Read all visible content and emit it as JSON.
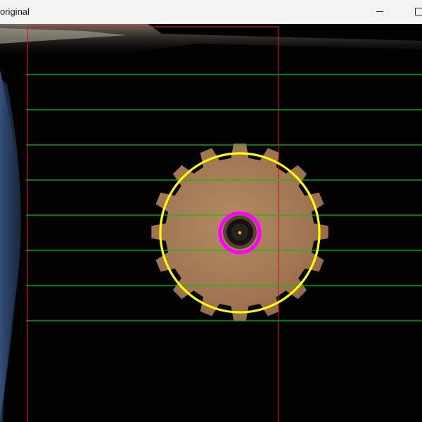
{
  "window": {
    "title": "original",
    "minimize_icon": "minimize-icon",
    "maximize_icon": "maximize-icon"
  },
  "overlay": {
    "outer_circle_color": "#ffff00",
    "inner_circle_color": "#ff00ff",
    "scan_line_color": "#00c800",
    "roi_rect_color": "#c81e1e",
    "center_marker_color": "#e6d200",
    "scan_line_count": 8
  },
  "scene": {
    "object": "spur-gear",
    "gear_color": "#a97c58",
    "tooth_count": 16
  }
}
